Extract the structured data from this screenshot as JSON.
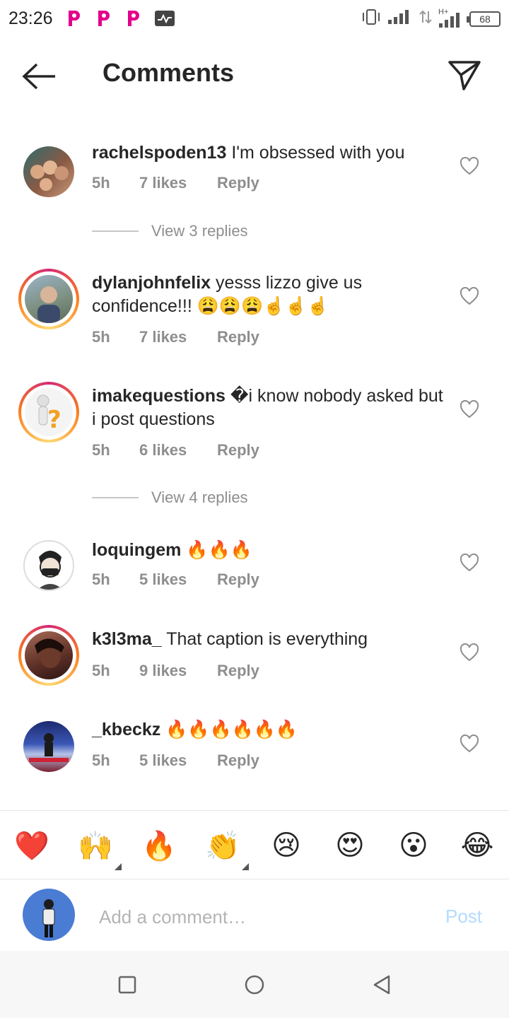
{
  "status_bar": {
    "time": "23:26",
    "battery": "68",
    "network": "H+"
  },
  "header": {
    "title": "Comments",
    "back_icon": "arrow-left-icon",
    "send_icon": "paper-plane-icon"
  },
  "comments": [
    {
      "username": "rachelspoden13",
      "text": "I'm obsessed with you",
      "time": "5h",
      "likes": "7 likes",
      "reply": "Reply",
      "view_replies": "View 3 replies",
      "story_ring": false
    },
    {
      "username": "dylanjohnfelix",
      "text": "yesss lizzo give us confidence!!! 😩😩😩☝☝☝",
      "time": "5h",
      "likes": "7 likes",
      "reply": "Reply",
      "story_ring": true
    },
    {
      "username": "imakequestions",
      "text": "�i know nobody asked but i post questions",
      "time": "5h",
      "likes": "6 likes",
      "reply": "Reply",
      "view_replies": "View 4 replies",
      "story_ring": true
    },
    {
      "username": "loquingem",
      "text": "🔥🔥🔥",
      "time": "5h",
      "likes": "5 likes",
      "reply": "Reply",
      "story_ring": false
    },
    {
      "username": "k3l3ma_",
      "text": "That caption is everything",
      "time": "5h",
      "likes": "9 likes",
      "reply": "Reply",
      "story_ring": true
    },
    {
      "username": "_kbeckz",
      "text": "🔥🔥🔥🔥🔥🔥",
      "time": "5h",
      "likes": "5 likes",
      "reply": "Reply",
      "story_ring": false
    }
  ],
  "quick_emojis": [
    "❤️",
    "🙌",
    "🔥",
    "👏",
    "😢",
    "😍",
    "😮",
    "😂"
  ],
  "comment_bar": {
    "placeholder": "Add a comment…",
    "post_label": "Post"
  },
  "colors": {
    "text": "#262626",
    "muted": "#8e8e8e",
    "post_disabled": "#b3dbff",
    "ring_start": "#d62976",
    "ring_end": "#fa7e1e"
  }
}
